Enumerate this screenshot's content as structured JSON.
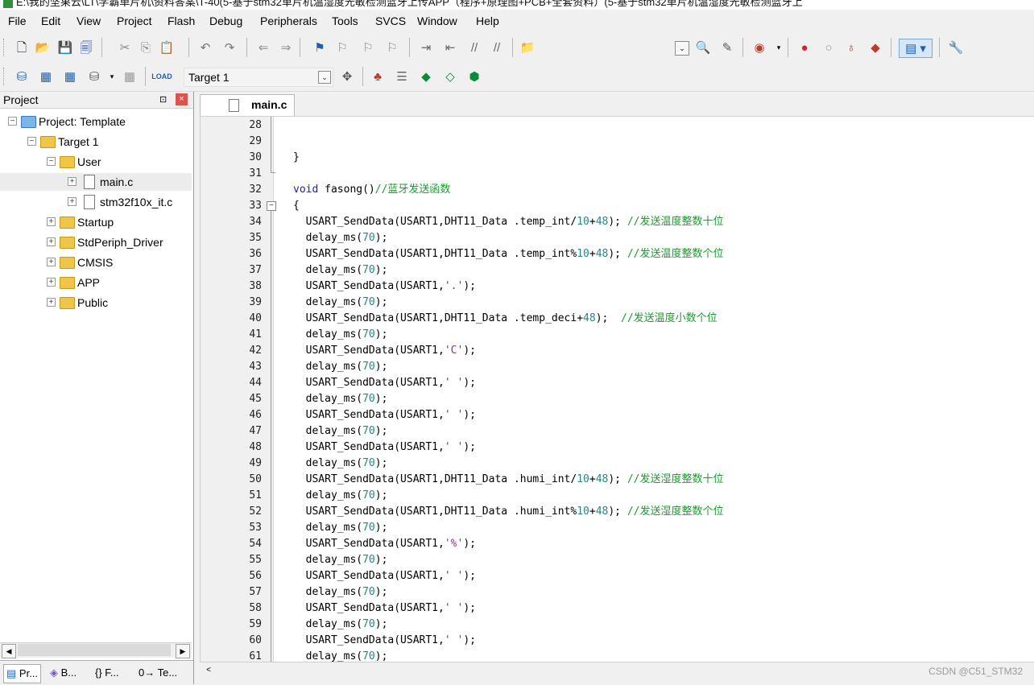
{
  "window": {
    "title": "E:\\我的坚果云\\LT\\学霸单片机\\资料答案\\T-40(5-基于stm32单片机温湿度光敏检测蓝牙上传APP（程序+原理图+PCB+全套资料）(5-基于stm32单片机温湿度光敏检测蓝牙上"
  },
  "menu": [
    "File",
    "Edit",
    "View",
    "Project",
    "Flash",
    "Debug",
    "Peripherals",
    "Tools",
    "SVCS",
    "Window",
    "Help"
  ],
  "toolbar2": {
    "target": "Target 1"
  },
  "project_panel": {
    "title": "Project",
    "pin": "⊡",
    "close": "×",
    "tree": [
      {
        "label": "Project: Template",
        "level": 0,
        "toggle": "⊟",
        "kind": "project"
      },
      {
        "label": "Target 1",
        "level": 1,
        "toggle": "⊟",
        "kind": "target"
      },
      {
        "label": "User",
        "level": 2,
        "toggle": "⊟",
        "kind": "folder"
      },
      {
        "label": "main.c",
        "level": 3,
        "toggle": "⊞",
        "kind": "file"
      },
      {
        "label": "stm32f10x_it.c",
        "level": 3,
        "toggle": "⊞",
        "kind": "file"
      },
      {
        "label": "Startup",
        "level": 2,
        "toggle": "⊞",
        "kind": "folder"
      },
      {
        "label": "StdPeriph_Driver",
        "level": 2,
        "toggle": "⊞",
        "kind": "folder"
      },
      {
        "label": "CMSIS",
        "level": 2,
        "toggle": "⊞",
        "kind": "folder"
      },
      {
        "label": "APP",
        "level": 2,
        "toggle": "⊞",
        "kind": "folder"
      },
      {
        "label": "Public",
        "level": 2,
        "toggle": "⊞",
        "kind": "folder"
      }
    ],
    "bottom_tabs": [
      "Pr...",
      "B...",
      "{} F...",
      "0→ Te..."
    ]
  },
  "editor": {
    "tab": "main.c",
    "lines": [
      {
        "n": "28",
        "t": ""
      },
      {
        "n": "29",
        "t": ""
      },
      {
        "n": "30",
        "t": "}"
      },
      {
        "n": "31",
        "t": ""
      },
      {
        "n": "32",
        "t": "void fasong()//蓝牙发送函数"
      },
      {
        "n": "33",
        "t": "{"
      },
      {
        "n": "34",
        "t": "  USART_SendData(USART1,DHT11_Data .temp_int/10+48); //发送温度整数十位"
      },
      {
        "n": "35",
        "t": "  delay_ms(70);"
      },
      {
        "n": "36",
        "t": "  USART_SendData(USART1,DHT11_Data .temp_int%10+48); //发送温度整数个位"
      },
      {
        "n": "37",
        "t": "  delay_ms(70);"
      },
      {
        "n": "38",
        "t": "  USART_SendData(USART1,'.');"
      },
      {
        "n": "39",
        "t": "  delay_ms(70);"
      },
      {
        "n": "40",
        "t": "  USART_SendData(USART1,DHT11_Data .temp_deci+48);  //发送温度小数个位"
      },
      {
        "n": "41",
        "t": "  delay_ms(70);"
      },
      {
        "n": "42",
        "t": "  USART_SendData(USART1,'C');"
      },
      {
        "n": "43",
        "t": "  delay_ms(70);"
      },
      {
        "n": "44",
        "t": "  USART_SendData(USART1,' ');"
      },
      {
        "n": "45",
        "t": "  delay_ms(70);"
      },
      {
        "n": "46",
        "t": "  USART_SendData(USART1,' ');"
      },
      {
        "n": "47",
        "t": "  delay_ms(70);"
      },
      {
        "n": "48",
        "t": "  USART_SendData(USART1,' ');"
      },
      {
        "n": "49",
        "t": "  delay_ms(70);"
      },
      {
        "n": "50",
        "t": "  USART_SendData(USART1,DHT11_Data .humi_int/10+48); //发送湿度整数十位"
      },
      {
        "n": "51",
        "t": "  delay_ms(70);"
      },
      {
        "n": "52",
        "t": "  USART_SendData(USART1,DHT11_Data .humi_int%10+48); //发送湿度整数个位"
      },
      {
        "n": "53",
        "t": "  delay_ms(70);"
      },
      {
        "n": "54",
        "t": "  USART_SendData(USART1,'%');"
      },
      {
        "n": "55",
        "t": "  delay_ms(70);"
      },
      {
        "n": "56",
        "t": "  USART_SendData(USART1,' ');"
      },
      {
        "n": "57",
        "t": "  delay_ms(70);"
      },
      {
        "n": "58",
        "t": "  USART_SendData(USART1,' ');"
      },
      {
        "n": "59",
        "t": "  delay_ms(70);"
      },
      {
        "n": "60",
        "t": "  USART_SendData(USART1,' ');"
      },
      {
        "n": "61",
        "t": "  delay_ms(70);"
      }
    ]
  },
  "watermark": "CSDN @C51_STM32",
  "colors": {
    "keyword": "#1e1e9e",
    "number": "#1a8a8a",
    "comment": "#16a02a",
    "string": "#9b26a0",
    "close": "#d9534f"
  }
}
